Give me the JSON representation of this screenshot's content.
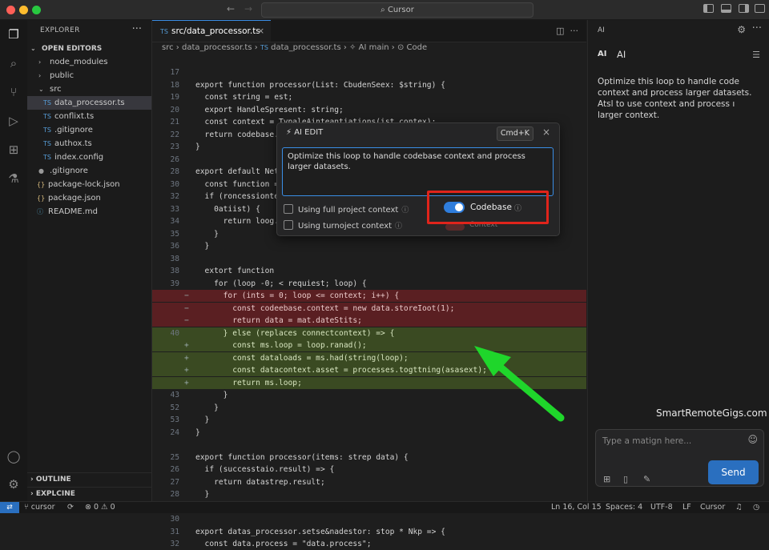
{
  "window": {
    "command_center": "Cursor"
  },
  "sidebar": {
    "title": "EXPLORER",
    "open_editors": "OPEN EDITORS",
    "items": [
      {
        "label": "node_modules",
        "icon": "chevron-right-icon"
      },
      {
        "label": "public",
        "icon": "chevron-right-icon"
      },
      {
        "label": "src",
        "icon": "chevron-down-icon"
      },
      {
        "label": "data_processor.ts",
        "icon": "TS",
        "selected": true
      },
      {
        "label": "conflixt.ts",
        "icon": "TS"
      },
      {
        "label": ".gitignore",
        "icon": "TS"
      },
      {
        "label": "authox.ts",
        "icon": "TS"
      },
      {
        "label": "index.config",
        "icon": "TS"
      },
      {
        "label": ".gitignore",
        "icon": "dot-icon"
      },
      {
        "label": "package-lock.json",
        "icon": "{}"
      },
      {
        "label": "package.json",
        "icon": "{}"
      },
      {
        "label": "README.md",
        "icon": "info-icon"
      }
    ],
    "outline": "OUTLINE",
    "timeline": "EXPLCINE"
  },
  "editor": {
    "tab": {
      "icon": "TS",
      "label": "src/data_processor.ts"
    },
    "breadcrumb": {
      "part1": "src",
      "sep": "›",
      "file_icon": "TS",
      "part2": "data_processor.ts",
      "part3": "AI main",
      "part4": "Code"
    },
    "lines": [
      {
        "n": "17",
        "mk": "",
        "t": "",
        "type": ""
      },
      {
        "n": "18",
        "mk": "",
        "t": "export function processor(List: CbudenSeex: $string) {",
        "type": ""
      },
      {
        "n": "19",
        "mk": "",
        "t": "  const string = est;",
        "type": ""
      },
      {
        "n": "20",
        "mk": "",
        "t": "  export HandleSpresent: string;",
        "type": ""
      },
      {
        "n": "21",
        "mk": "",
        "t": "  const context = TypaleAinteantiations(ist.contex);",
        "type": ""
      },
      {
        "n": "22",
        "mk": "",
        "t": "  return codebase.czo",
        "type": ""
      },
      {
        "n": "23",
        "mk": "",
        "t": "}",
        "type": ""
      },
      {
        "n": "26",
        "mk": "",
        "t": "",
        "type": ""
      },
      {
        "n": "28",
        "mk": "",
        "t": "export default Net",
        "type": ""
      },
      {
        "n": "30",
        "mk": "",
        "t": "  const function =",
        "type": ""
      },
      {
        "n": "32",
        "mk": "",
        "t": "  if (roncessionte",
        "type": ""
      },
      {
        "n": "33",
        "mk": "",
        "t": "    0atiist) {",
        "type": ""
      },
      {
        "n": "34",
        "mk": "",
        "t": "      return loog.",
        "type": ""
      },
      {
        "n": "35",
        "mk": "",
        "t": "    }",
        "type": ""
      },
      {
        "n": "36",
        "mk": "",
        "t": "  }",
        "type": ""
      },
      {
        "n": "38",
        "mk": "",
        "t": "",
        "type": ""
      },
      {
        "n": "38",
        "mk": "",
        "t": "  extort function ",
        "type": ""
      },
      {
        "n": "39",
        "mk": "",
        "t": "    for (loop -0; < requiest; loop) {",
        "type": ""
      },
      {
        "n": "",
        "mk": "−",
        "t": "      for (ints = 0; loop <= context; i++) {",
        "type": "del"
      },
      {
        "n": "",
        "mk": "−",
        "t": "        const codeebase.context = new data.storeIoot(1);",
        "type": "del"
      },
      {
        "n": "",
        "mk": "−",
        "t": "        return data = mat.dateStits;",
        "type": "del"
      },
      {
        "n": "40",
        "mk": "",
        "t": "      } else (replaces connectcontext) => {",
        "type": "add"
      },
      {
        "n": "",
        "mk": "+",
        "t": "        const ms.loop = loop.ranad();",
        "type": "add"
      },
      {
        "n": "",
        "mk": "+",
        "t": "        const dataloads = ms.had(string(loop);",
        "type": "add"
      },
      {
        "n": "",
        "mk": "+",
        "t": "        const datacontext.asset = processes.togttning(asasext);",
        "type": "add"
      },
      {
        "n": "",
        "mk": "+",
        "t": "        return ms.loop;",
        "type": "add"
      },
      {
        "n": "43",
        "mk": "",
        "t": "      }",
        "type": ""
      },
      {
        "n": "52",
        "mk": "",
        "t": "    }",
        "type": ""
      },
      {
        "n": "53",
        "mk": "",
        "t": "  }",
        "type": ""
      },
      {
        "n": "24",
        "mk": "",
        "t": "}",
        "type": ""
      },
      {
        "n": "",
        "mk": "",
        "t": "",
        "type": ""
      },
      {
        "n": "25",
        "mk": "",
        "t": "export function processor(items: strep data) {",
        "type": ""
      },
      {
        "n": "26",
        "mk": "",
        "t": "  if (successtaio.result) => {",
        "type": ""
      },
      {
        "n": "27",
        "mk": "",
        "t": "    return datastrep.result;",
        "type": ""
      },
      {
        "n": "28",
        "mk": "",
        "t": "  }",
        "type": ""
      },
      {
        "n": "29",
        "mk": "",
        "t": "}",
        "type": ""
      },
      {
        "n": "30",
        "mk": "",
        "t": "",
        "type": ""
      },
      {
        "n": "31",
        "mk": "",
        "t": "export datas_processor.setse&nadestor: stop * Nkp => {",
        "type": ""
      },
      {
        "n": "32",
        "mk": "",
        "t": "  const data.process = \"data.process\";",
        "type": ""
      }
    ]
  },
  "ai_edit": {
    "title": "AI EDIT",
    "shortcut": "Cmd+K",
    "prompt": "Optimize this loop to handle codebase context and process larger datasets.",
    "options": [
      {
        "label": "Using full project context"
      },
      {
        "label": "Using turnoject context"
      }
    ],
    "codebase_label": "Codebase",
    "codebase_enabled": true,
    "ghost_label": "Context"
  },
  "ai_panel": {
    "header": "AI",
    "badge": "AI",
    "name": "AI",
    "message": "Optimize this loop to handle code context and process larger datasets. Atsl to use context and process ı larger context.",
    "watermark": "SmartRemoteGigs.com",
    "input_placeholder": "Type a matign here...",
    "send_label": "Send"
  },
  "statusbar": {
    "branch": "cursor",
    "problems": "0 ⚠ 0",
    "position": "Ln 16, Col 15",
    "spaces": "Spaces: 4",
    "encoding": "UTF-8",
    "eol": "LF",
    "app": "Cursor"
  },
  "colors": {
    "accent": "#2f7ddc",
    "highlight": "#e0241b",
    "arrow": "#1fd62b"
  }
}
